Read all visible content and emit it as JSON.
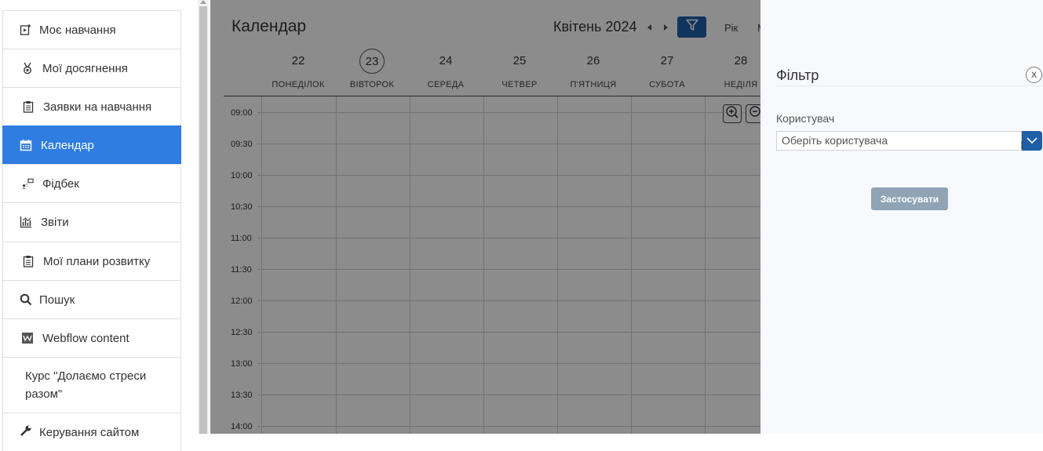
{
  "sidebar": {
    "items": [
      {
        "label": "Моє навчання",
        "icon": "my-learning-icon"
      },
      {
        "label": "Мої досягнення",
        "icon": "medal-icon"
      },
      {
        "label": "Заявки на навчання",
        "icon": "clipboard-icon"
      },
      {
        "label": "Календар",
        "icon": "calendar-icon",
        "active": true
      },
      {
        "label": "Фідбек",
        "icon": "feedback-icon"
      },
      {
        "label": "Звіти",
        "icon": "reports-chart-icon"
      },
      {
        "label": "Мої плани розвитку",
        "icon": "clipboard-icon"
      },
      {
        "label": "Пошук",
        "icon": "search-icon"
      },
      {
        "label": "Webflow content",
        "icon": "webflow-icon"
      },
      {
        "label_line1": "Курс \"Долаємо стреси",
        "label_line2": "разом\""
      },
      {
        "label": "Керування сайтом",
        "icon": "wrench-icon"
      }
    ]
  },
  "calendar": {
    "title": "Календар",
    "month": "Квітень 2024",
    "views": {
      "year": "Рік",
      "month": "М"
    },
    "days": [
      {
        "num": "22",
        "name": "ПОНЕДІЛОК"
      },
      {
        "num": "23",
        "name": "ВІВТОРОК",
        "today": true
      },
      {
        "num": "24",
        "name": "СЕРЕДА"
      },
      {
        "num": "25",
        "name": "ЧЕТВЕР"
      },
      {
        "num": "26",
        "name": "П'ЯТНИЦЯ"
      },
      {
        "num": "27",
        "name": "СУБОТА"
      },
      {
        "num": "28",
        "name": "НЕДІЛЯ"
      }
    ],
    "times": [
      "09:00",
      "09:30",
      "10:00",
      "10:30",
      "11:00",
      "11:30",
      "12:00",
      "12:30",
      "13:00",
      "13:30",
      "14:00"
    ]
  },
  "filter_panel": {
    "title": "Фільтр",
    "close": "X",
    "user_label": "Користувач",
    "user_placeholder": "Оберіть користувача",
    "apply": "Застосувати"
  },
  "colors": {
    "accent": "#2f7de1",
    "primary_button": "#1f5fa8",
    "apply_button": "#8fa4b5",
    "panel_background": "#f8f9fc"
  }
}
